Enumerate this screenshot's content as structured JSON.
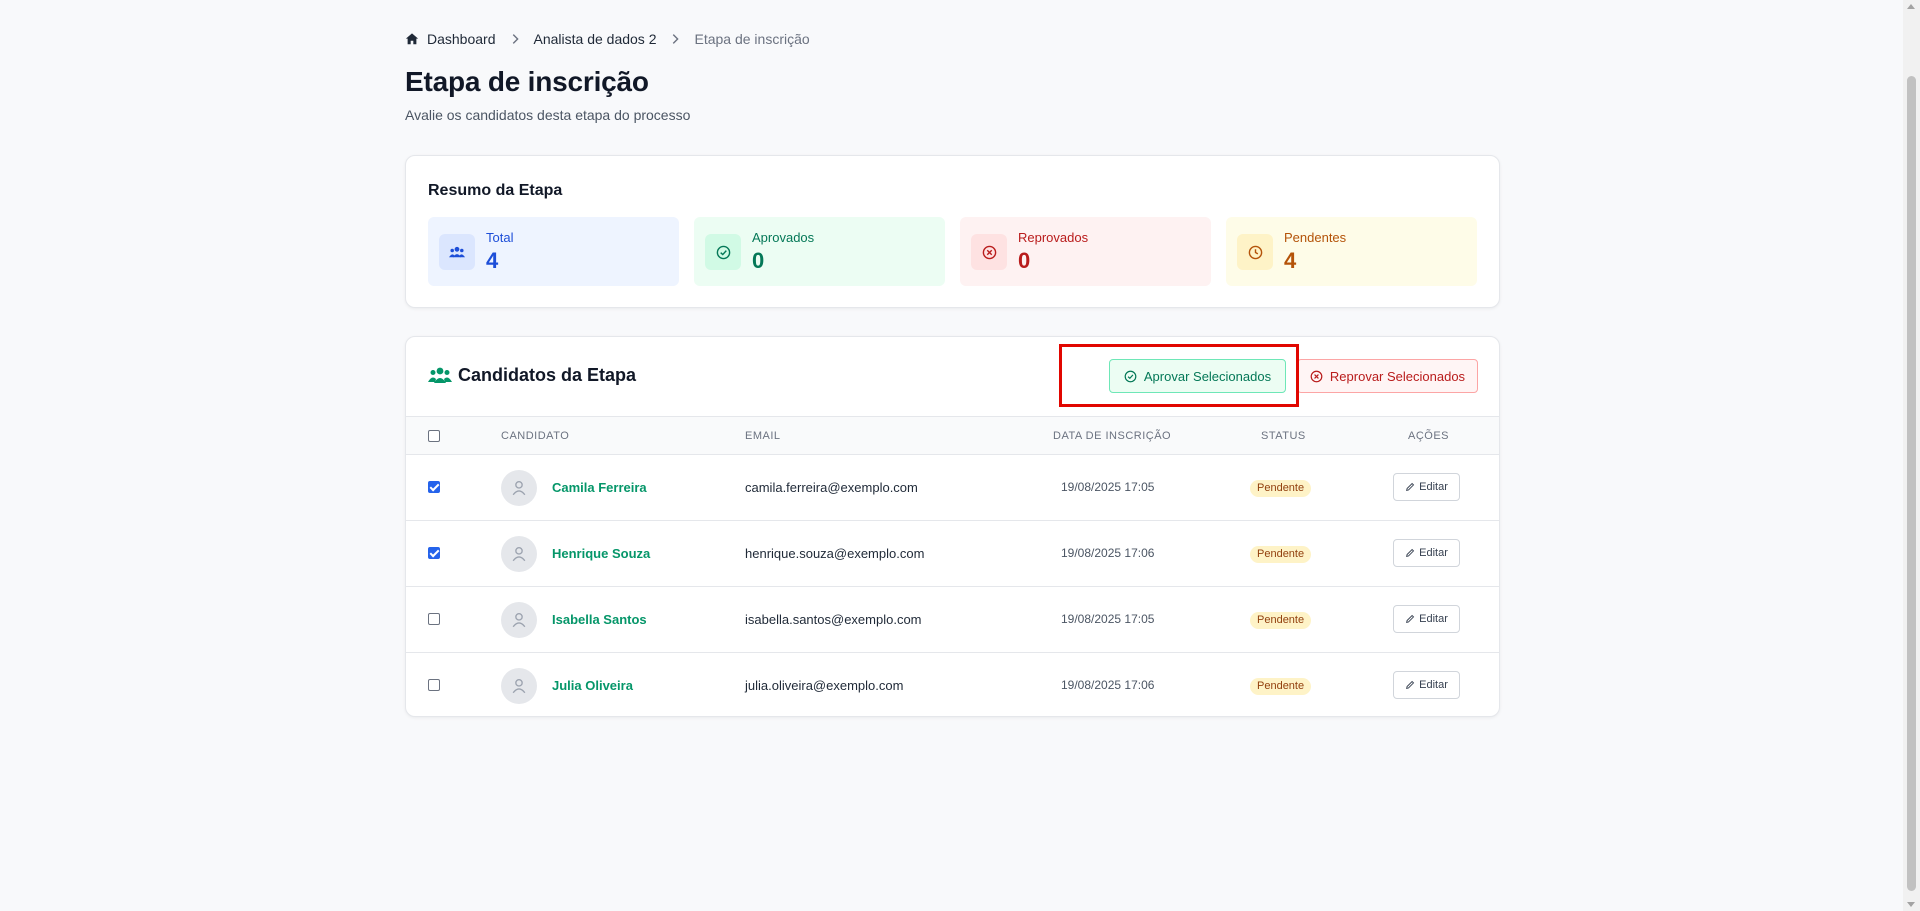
{
  "breadcrumb": {
    "home": "Dashboard",
    "parent": "Analista de dados 2",
    "current": "Etapa de inscrição"
  },
  "page": {
    "title": "Etapa de inscrição",
    "subtitle": "Avalie os candidatos desta etapa do processo"
  },
  "summary": {
    "title": "Resumo da Etapa",
    "stats": [
      {
        "label": "Total",
        "value": "4",
        "icon": "users-icon",
        "color": "#1d4ed8"
      },
      {
        "label": "Aprovados",
        "value": "0",
        "icon": "check-circle-icon",
        "color": "#047857"
      },
      {
        "label": "Reprovados",
        "value": "0",
        "icon": "x-circle-icon",
        "color": "#b91c1c"
      },
      {
        "label": "Pendentes",
        "value": "4",
        "icon": "clock-icon",
        "color": "#b45309"
      }
    ]
  },
  "candidates": {
    "title": "Candidatos da Etapa",
    "approve_label": "Aprovar Selecionados",
    "reject_label": "Reprovar Selecionados",
    "columns": [
      "CANDIDATO",
      "EMAIL",
      "DATA DE INSCRIÇÃO",
      "STATUS",
      "AÇÕES"
    ],
    "rows": [
      {
        "name": "Camila Ferreira",
        "email": "camila.ferreira@exemplo.com",
        "date": "19/08/2025 17:05",
        "status": "Pendente",
        "action": "Editar",
        "checked": true
      },
      {
        "name": "Henrique Souza",
        "email": "henrique.souza@exemplo.com",
        "date": "19/08/2025 17:06",
        "status": "Pendente",
        "action": "Editar",
        "checked": true
      },
      {
        "name": "Isabella Santos",
        "email": "isabella.santos@exemplo.com",
        "date": "19/08/2025 17:05",
        "status": "Pendente",
        "action": "Editar",
        "checked": false
      },
      {
        "name": "Julia Oliveira",
        "email": "julia.oliveira@exemplo.com",
        "date": "19/08/2025 17:06",
        "status": "Pendente",
        "action": "Editar",
        "checked": false
      }
    ]
  },
  "colors": {
    "accent_green": "#059669",
    "highlight_red": "#e10600",
    "pending_badge": "#fef3c7"
  }
}
